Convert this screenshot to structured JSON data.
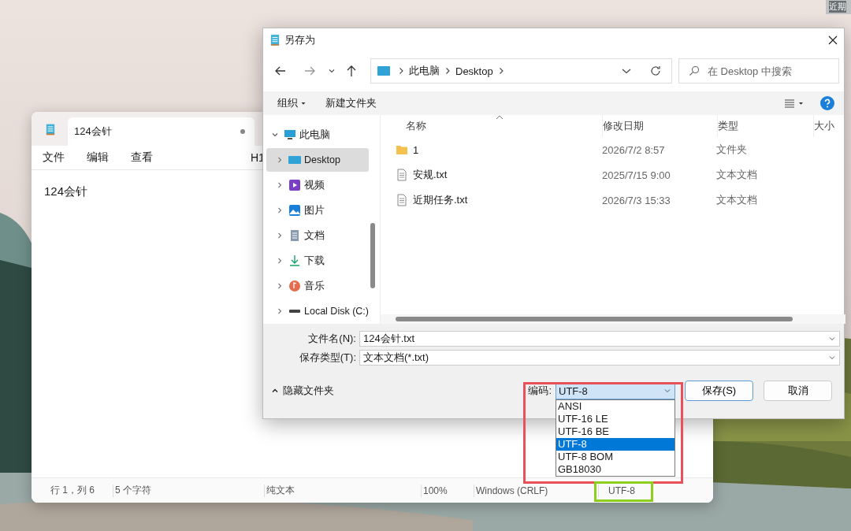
{
  "desktop": {
    "icon_label": "近期"
  },
  "notepad": {
    "tab_title": "124会针",
    "tab_modified": true,
    "menu": [
      "文件",
      "编辑",
      "查看"
    ],
    "toolbar_item": "H1",
    "content": "124会针",
    "status": [
      "行 1，列 6",
      "5 个字符",
      "纯文本",
      "100%",
      "Windows (CRLF)",
      "UTF-8"
    ]
  },
  "dialog": {
    "title": "另存为",
    "address": [
      "此电脑",
      "Desktop"
    ],
    "search": {
      "placeholder": "在 Desktop 中搜索"
    },
    "toolbar": [
      "组织",
      "新建文件夹"
    ],
    "nav_tree": [
      {
        "label": "此电脑",
        "kind": "pc",
        "expanded": true,
        "selected": false,
        "children": [
          {
            "label": "Desktop",
            "kind": "desktop",
            "expanded": false,
            "selected": true
          },
          {
            "label": "视频",
            "kind": "video",
            "expanded": false,
            "selected": false
          },
          {
            "label": "图片",
            "kind": "pictures",
            "expanded": false,
            "selected": false
          },
          {
            "label": "文档",
            "kind": "documents",
            "expanded": false,
            "selected": false
          },
          {
            "label": "下载",
            "kind": "downloads",
            "expanded": false,
            "selected": false
          },
          {
            "label": "音乐",
            "kind": "music",
            "expanded": false,
            "selected": false
          },
          {
            "label": "Local Disk (C:)",
            "kind": "disk",
            "expanded": false,
            "selected": false
          }
        ]
      }
    ],
    "columns": [
      "名称",
      "修改日期",
      "类型",
      "大小"
    ],
    "files": [
      {
        "name": "1",
        "date": "2026/7/2 8:57",
        "type": "文件夹",
        "kind": "folder"
      },
      {
        "name": "安规.txt",
        "date": "2025/7/15 9:00",
        "type": "文本文档",
        "kind": "text"
      },
      {
        "name": "近期任务.txt",
        "date": "2026/7/3 15:33",
        "type": "文本文档",
        "kind": "text"
      }
    ],
    "filename": {
      "label": "文件名(N):",
      "value": "124会针.txt"
    },
    "filetype": {
      "label": "保存类型(T):",
      "value": "文本文档(*.txt)"
    },
    "hide_folders": "隐藏文件夹",
    "encoding": {
      "label": "编码:",
      "value": "UTF-8",
      "options": [
        {
          "label": "ANSI",
          "selected": false
        },
        {
          "label": "UTF-16 LE",
          "selected": false
        },
        {
          "label": "UTF-16 BE",
          "selected": false
        },
        {
          "label": "UTF-8",
          "selected": true
        },
        {
          "label": "UTF-8 BOM",
          "selected": false
        },
        {
          "label": "GB18030",
          "selected": false
        }
      ]
    },
    "buttons": [
      "保存(S)",
      "取消"
    ]
  },
  "annotations": [
    {
      "kind": "dropdown",
      "color": "#e8505a"
    },
    {
      "kind": "status",
      "color": "#8ccf1c"
    }
  ]
}
